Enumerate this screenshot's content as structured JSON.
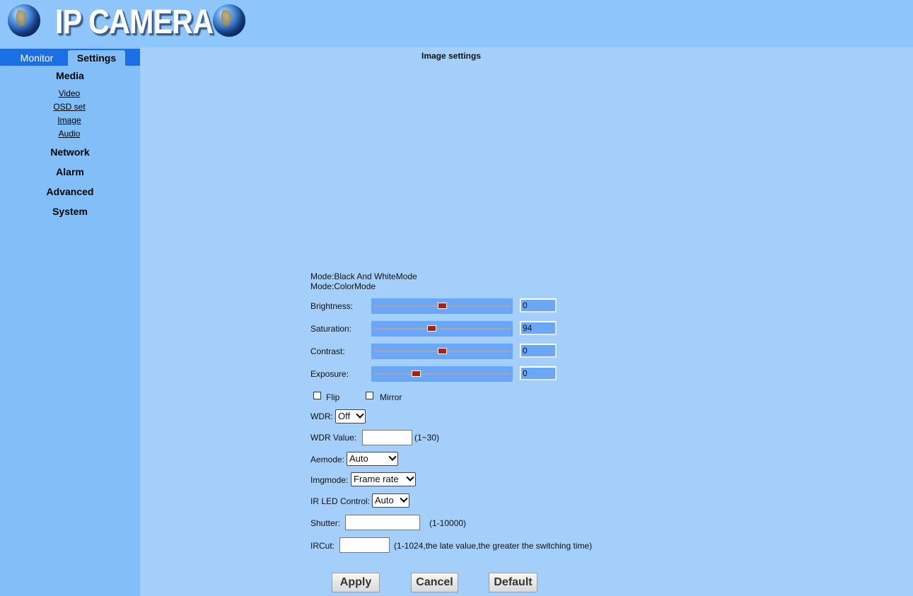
{
  "header": {
    "logo_text": "IP CAMERA"
  },
  "tabs": [
    {
      "label": "Monitor"
    },
    {
      "label": "Settings"
    }
  ],
  "menu": {
    "media": "Media",
    "media_items": [
      "Video",
      "OSD set",
      "Image",
      "Audio"
    ],
    "network": "Network",
    "alarm": "Alarm",
    "advanced": "Advanced",
    "system": "System"
  },
  "page_title": "Image settings",
  "modes": {
    "bw": "Mode:Black And WhiteMode",
    "color": "Mode:ColorMode"
  },
  "sliders": [
    {
      "label": "Brightness:",
      "value": "0",
      "level": 0.5
    },
    {
      "label": "Saturation:",
      "value": "94",
      "level": 0.42
    },
    {
      "label": "Contrast:",
      "value": "0",
      "level": 0.5
    },
    {
      "label": "Exposure:",
      "value": "0",
      "level": 0.3
    }
  ],
  "checkboxes": {
    "flip": "Flip",
    "mirror": "Mirror"
  },
  "wdr": {
    "label": "WDR:",
    "value": "Off"
  },
  "wdr_value": {
    "label": "WDR Value:",
    "value": "",
    "hint": "(1~30)"
  },
  "aemode": {
    "label": "Aemode:",
    "value": "Auto"
  },
  "imgmode": {
    "label": "Imgmode:",
    "value": "Frame rate"
  },
  "ir_led": {
    "label": "IR LED Control:",
    "value": "Auto"
  },
  "shutter": {
    "label": "Shutter:",
    "value": "",
    "hint": "(1-10000)"
  },
  "ircut": {
    "label": "IRCut:",
    "value": "",
    "hint": "(1-1024,the late value,the greater the switching time)"
  },
  "buttons": {
    "apply": "Apply",
    "cancel": "Cancel",
    "default": "Default"
  },
  "colors": {
    "header_bg": "#8ec6fb",
    "sidebar_bg": "#82bff9",
    "content_bg": "#a4cffa",
    "tab_bar": "#1a6fe6",
    "slider_thumb": "#b81c10"
  }
}
